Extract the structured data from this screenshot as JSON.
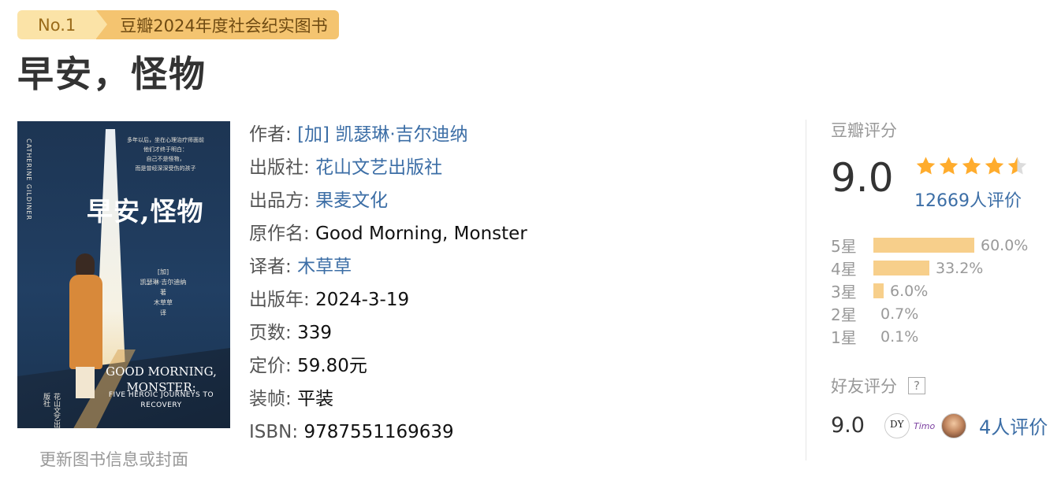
{
  "badge": {
    "rank": "No.1",
    "award": "豆瓣2024年度社会纪实图书"
  },
  "book": {
    "title": "早安，怪物",
    "update_link": "更新图书信息或封面"
  },
  "cover": {
    "title_cn": "早安,怪物",
    "blurb": "多年以后，坐在心理治疗师面前\n他们才终于明白：\n自己不是怪物，\n而是曾经深深受伤的孩子",
    "side_text": "CATHERINE GILDINER",
    "author_block": "[加]\n凯瑟琳·吉尔迪纳\n著\n木草草\n译",
    "title_en": "GOOD MORNING, MONSTER:",
    "subtitle_en": "FIVE HEROIC JOURNEYS TO RECOVERY",
    "seal": "花山文艺出版社"
  },
  "info": {
    "author_label": "作者:",
    "author_value": "[加] 凯瑟琳·吉尔迪纳",
    "publisher_label": "出版社:",
    "publisher_value": "花山文艺出版社",
    "producer_label": "出品方:",
    "producer_value": "果麦文化",
    "original_title_label": "原作名:",
    "original_title_value": "Good Morning, Monster",
    "translator_label": "译者:",
    "translator_value": "木草草",
    "pub_year_label": "出版年:",
    "pub_year_value": "2024-3-19",
    "pages_label": "页数:",
    "pages_value": "339",
    "price_label": "定价:",
    "price_value": "59.80元",
    "binding_label": "装帧:",
    "binding_value": "平装",
    "isbn_label": "ISBN:",
    "isbn_value": "9787551169639"
  },
  "rating": {
    "heading": "豆瓣评分",
    "score": "9.0",
    "stars": 4.5,
    "votes": "12669人评价",
    "distribution": [
      {
        "label": "5星",
        "pct": "60.0%",
        "value": 60.0
      },
      {
        "label": "4星",
        "pct": "33.2%",
        "value": 33.2
      },
      {
        "label": "3星",
        "pct": "6.0%",
        "value": 6.0
      },
      {
        "label": "2星",
        "pct": "0.7%",
        "value": 0.7
      },
      {
        "label": "1星",
        "pct": "0.1%",
        "value": 0.1
      }
    ]
  },
  "friends": {
    "heading": "好友评分",
    "help_icon": "?",
    "score": "9.0",
    "votes": "4人评价"
  },
  "colors": {
    "link": "#3c6ea6",
    "bar": "#f7cf8b",
    "star": "#ffac2d",
    "badge_left": "#fbe3a7",
    "badge_right": "#f4c470"
  }
}
